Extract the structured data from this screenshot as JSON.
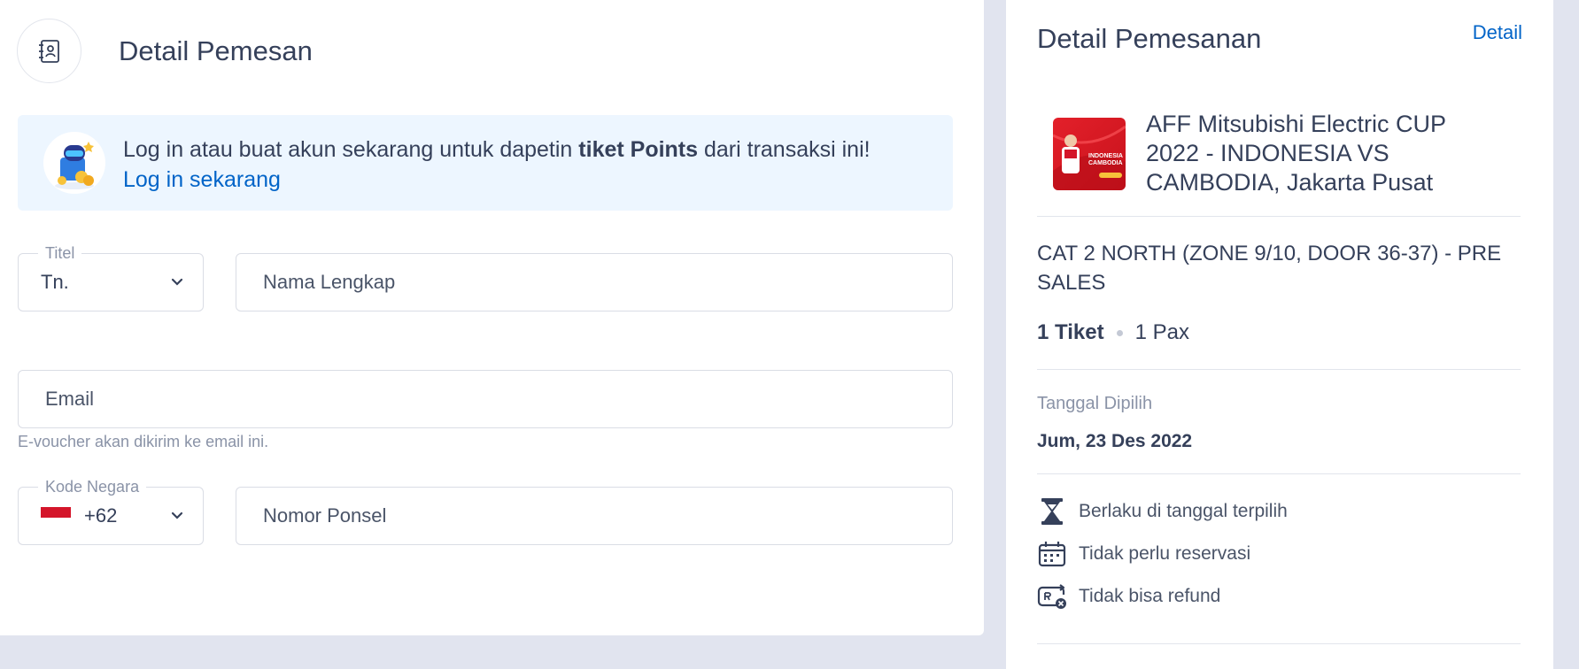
{
  "pemesan": {
    "title": "Detail Pemesan",
    "banner": {
      "text_before": "Log in atau buat akun sekarang untuk dapetin ",
      "text_bold": "tiket Points",
      "text_after": " dari transaksi ini!",
      "link": "Log in sekarang"
    },
    "titel": {
      "legend": "Titel",
      "value": "Tn."
    },
    "nama": {
      "placeholder": "Nama Lengkap"
    },
    "email": {
      "placeholder": "Email",
      "helper": "E-voucher akan dikirim ke email ini."
    },
    "kode_negara": {
      "legend": "Kode Negara",
      "value": "+62"
    },
    "ponsel": {
      "placeholder": "Nomor Ponsel"
    }
  },
  "pemesanan": {
    "title": "Detail Pemesanan",
    "detail_link": "Detail",
    "event_title": "AFF Mitsubishi Electric CUP 2022 - INDONESIA VS CAMBODIA, Jakarta Pusat",
    "thumb_text": "INDONESIA CAMBODIA",
    "category": "CAT 2 NORTH (ZONE 9/10, DOOR 36-37) - PRE SALES",
    "qty_tiket": "1 Tiket",
    "qty_pax": "1 Pax",
    "date_label": "Tanggal Dipilih",
    "date_value": "Jum, 23 Des 2022",
    "policies": [
      {
        "icon": "hourglass-icon",
        "text": "Berlaku di tanggal terpilih"
      },
      {
        "icon": "calendar-icon",
        "text": "Tidak perlu reservasi"
      },
      {
        "icon": "no-refund-icon",
        "text": "Tidak bisa refund"
      }
    ]
  },
  "colors": {
    "page_bg": "#e1e4ef",
    "text": "#35405a",
    "link": "#0264c8",
    "banner_bg": "#edf6ff"
  }
}
